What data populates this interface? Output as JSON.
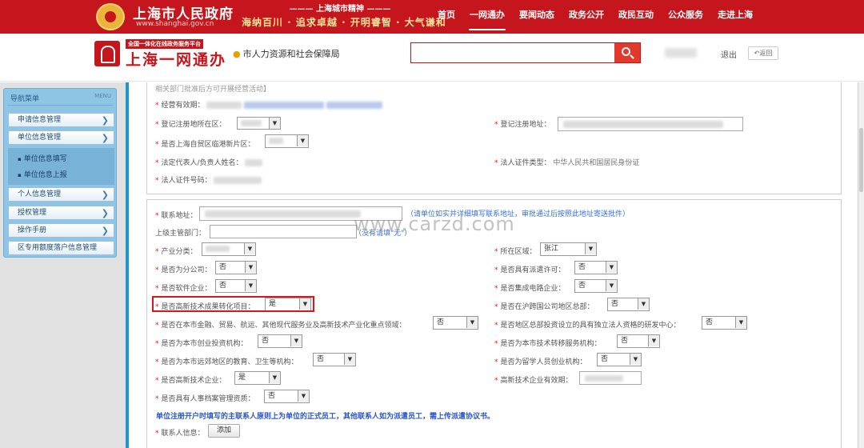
{
  "header": {
    "site_name": "上海市人民政府",
    "site_url": "www.shanghai.gov.cn",
    "motto_title": "上海城市精神",
    "motto": "海纳百川 · 追求卓越 · 开明睿智 · 大气谦和",
    "nav": [
      "首页",
      "一网通办",
      "要闻动态",
      "政务公开",
      "政民互动",
      "公众服务",
      "走进上海"
    ],
    "nav_active": "一网通办"
  },
  "subheader": {
    "platform_tag": "全国一体化在线政务服务平台",
    "platform_title": "上海一网通办",
    "location": "市人力资源和社会保障局",
    "logout": "退出",
    "back": "返回"
  },
  "sidebar": {
    "title": "导航菜单",
    "menu_label": "MENU",
    "items": [
      "申请信息管理",
      "单位信息管理",
      "个人信息管理",
      "授权管理",
      "操作手册",
      "区专用额度落户信息管理"
    ],
    "subitems": [
      "单位信息填写",
      "单位信息上报"
    ]
  },
  "form_top": {
    "cut_text": "相关部门批准后方可开展经营活动】",
    "business_period_label": "经营有效期：",
    "reg_district_label": "登记注册地所在区：",
    "reg_address_label": "登记注册地址：",
    "free_trade_label": "是否上海自贸区临港新片区：",
    "legal_rep_label": "法定代表人/负责人姓名：",
    "legal_id_type_label": "法人证件类型：",
    "legal_id_type_value": "中华人民共和国居民身份证",
    "legal_id_no_label": "法人证件号码："
  },
  "form_main": {
    "contact_address_label": "联系地址：",
    "contact_address_hint": "（请单位如实并详细填写联系地址，审批通过后按照此地址寄送批件）",
    "superior_label": "上级主管部门：",
    "superior_hint": "（没有请填\"无\"）",
    "industry_label": "产业分类：",
    "region_label": "所在区域：",
    "region_value": "张江",
    "branch_label": "是否为分公司：",
    "branch_value": "否",
    "dispatch_label": "是否具有派遣许可：",
    "dispatch_value": "否",
    "software_label": "是否软件企业：",
    "software_value": "否",
    "ic_label": "是否集成电路企业：",
    "ic_value": "否",
    "hightech_project_label": "是否高新技术成果转化项目：",
    "hightech_project_value": "是",
    "hq_label": "是否在沪跨国公司地区总部：",
    "hq_value": "否",
    "finance_label": "是否在本市金融、贸易、航运、其他现代服务业及高新技术产业化重点领域：",
    "finance_value": "否",
    "rd_label": "是否地区总部投资设立的具有独立法人资格的研发中心：",
    "rd_value": "否",
    "venture_label": "是否为本市创业投资机构：",
    "venture_value": "否",
    "tech_transfer_label": "是否为本市技术转移服务机构：",
    "tech_transfer_value": "否",
    "suburb_label": "是否为本市远郊地区的教育、卫生等机构：",
    "suburb_value": "否",
    "returnee_label": "是否为留学人员创业机构：",
    "returnee_value": "否",
    "hightech_ent_label": "是否高新技术企业：",
    "hightech_ent_value": "是",
    "hightech_validity_label": "高新技术企业有效期：",
    "archive_label": "是否具有人事档案管理资质：",
    "archive_value": "否",
    "note": "单位注册开户时填写的主联系人原则上为单位的正式员工，其他联系人如为派遣员工，需上传派遣协议书。",
    "contact_info_label": "联系人信息：",
    "add_button": "添加"
  },
  "watermark": "www.carzd.com",
  "colors": {
    "brand_red": "#c4161c",
    "sidebar_blue": "#8ec4e4",
    "frame_blue": "#1b95d6",
    "hint_blue": "#3b6fd6",
    "highlight_red": "#d8161c"
  }
}
